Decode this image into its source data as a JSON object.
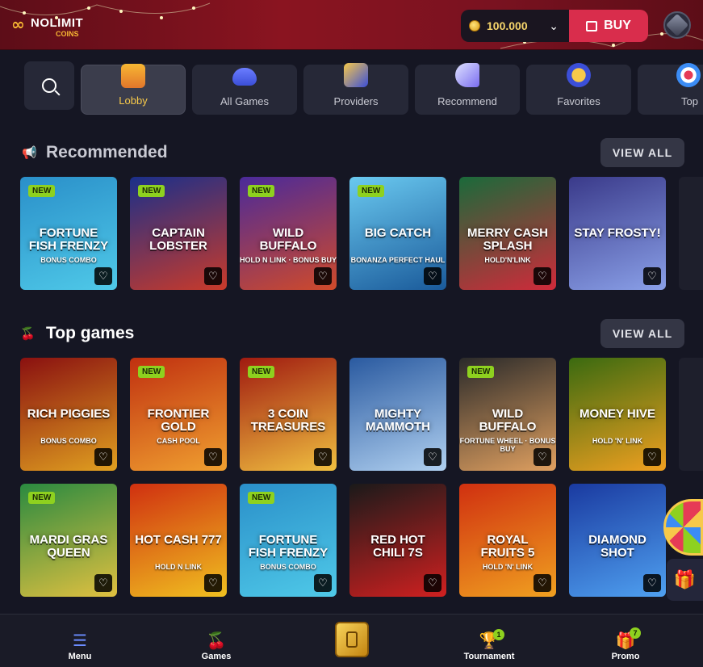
{
  "header": {
    "logo_text": "NOLIMIT",
    "logo_sub": "COINS",
    "balance": "100.000",
    "buy_label": "BUY"
  },
  "nav": {
    "tabs": [
      {
        "label": "Lobby",
        "icon": "slot-machine-icon",
        "active": true
      },
      {
        "label": "All Games",
        "icon": "gamepad-icon",
        "active": false
      },
      {
        "label": "Providers",
        "icon": "cards-icon",
        "active": false
      },
      {
        "label": "Recommend",
        "icon": "megaphone-icon",
        "active": false
      },
      {
        "label": "Favorites",
        "icon": "star-badge-icon",
        "active": false
      },
      {
        "label": "Top",
        "icon": "target-icon",
        "active": false
      }
    ]
  },
  "recommended": {
    "title": "Recommended",
    "view_all": "VIEW ALL",
    "games": [
      {
        "name": "Fortune Fish Frenzy",
        "sub": "BONUS COMBO",
        "new": true
      },
      {
        "name": "Captain Lobster",
        "sub": "",
        "new": true
      },
      {
        "name": "Wild Buffalo",
        "sub": "HOLD N LINK · BONUS BUY",
        "new": true
      },
      {
        "name": "Big Catch",
        "sub": "BONANZA PERFECT HAUL",
        "new": true
      },
      {
        "name": "Merry Cash Splash",
        "sub": "HOLD'N'LINK",
        "new": false
      },
      {
        "name": "Stay Frosty!",
        "sub": "",
        "new": false
      }
    ]
  },
  "top_games": {
    "title": "Top games",
    "view_all": "VIEW ALL",
    "row1": [
      {
        "name": "Rich Piggies",
        "sub": "BONUS COMBO",
        "new": false
      },
      {
        "name": "Frontier Gold",
        "sub": "CASH POOL",
        "new": true
      },
      {
        "name": "3 Coin Treasures",
        "sub": "",
        "new": true
      },
      {
        "name": "Mighty Mammoth",
        "sub": "",
        "new": false
      },
      {
        "name": "Wild Buffalo",
        "sub": "FORTUNE WHEEL · BONUS BUY",
        "new": true
      },
      {
        "name": "Money Hive",
        "sub": "HOLD 'N' LINK",
        "new": false
      }
    ],
    "row2": [
      {
        "name": "Mardi Gras Queen",
        "sub": "",
        "new": true
      },
      {
        "name": "Hot Cash 777",
        "sub": "HOLD N LINK",
        "new": false
      },
      {
        "name": "Fortune Fish Frenzy",
        "sub": "BONUS COMBO",
        "new": true
      },
      {
        "name": "Red Hot Chili 7s",
        "sub": "",
        "new": false
      },
      {
        "name": "Royal Fruits 5",
        "sub": "HOLD 'N' LINK",
        "new": false
      },
      {
        "name": "Diamond Shot",
        "sub": "",
        "new": false
      }
    ]
  },
  "badge_new": "NEW",
  "bottom_nav": {
    "items": [
      {
        "label": "Menu"
      },
      {
        "label": "Games"
      },
      {
        "label": "Tournament",
        "count": "1"
      },
      {
        "label": "Promo",
        "count": "7"
      }
    ]
  }
}
